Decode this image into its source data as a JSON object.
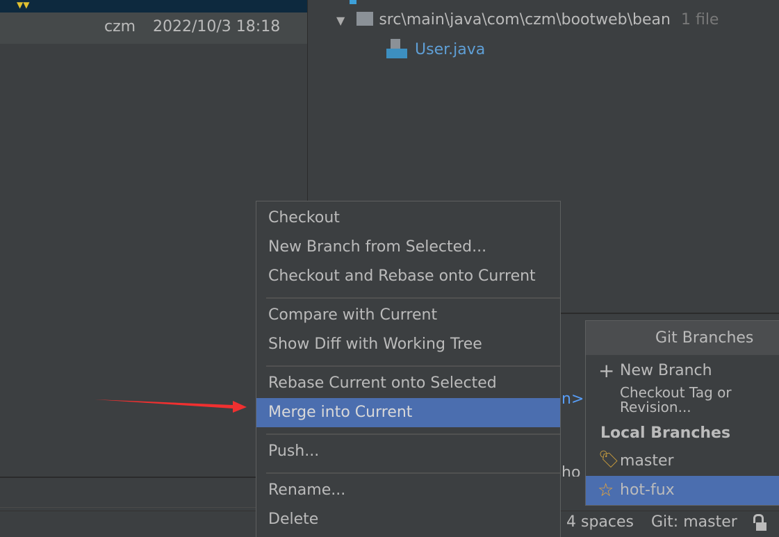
{
  "commit_row": {
    "author": "czm",
    "date": "2022/10/3 18:18"
  },
  "changes_tree": {
    "folder": "src\\main\\java\\com\\czm\\bootweb\\bean",
    "count": "1 file",
    "file": "User.java"
  },
  "context_menu": {
    "items": [
      "Checkout",
      "New Branch from Selected...",
      "Checkout and Rebase onto Current",
      "Compare with Current",
      "Show Diff with Working Tree",
      "Rebase Current onto Selected",
      "Merge into Current",
      "Push...",
      "Rename...",
      "Delete"
    ],
    "selected": "Merge into Current"
  },
  "background_fragments": {
    "link": "n>",
    "text": "ho"
  },
  "git_branches": {
    "title": "Git Branches",
    "new_branch": "New Branch",
    "checkout_tag": "Checkout Tag or Revision...",
    "section": "Local Branches",
    "branches": [
      "master",
      "hot-fux"
    ],
    "selected": "hot-fux"
  },
  "status_bar": {
    "indent": "4 spaces",
    "git": "Git: master"
  },
  "colors": {
    "selection": "#4b6eaf",
    "arrow": "#f03030",
    "tag": "#c59a3d",
    "star": "#f0a732",
    "file_link": "#5f9fd6"
  }
}
